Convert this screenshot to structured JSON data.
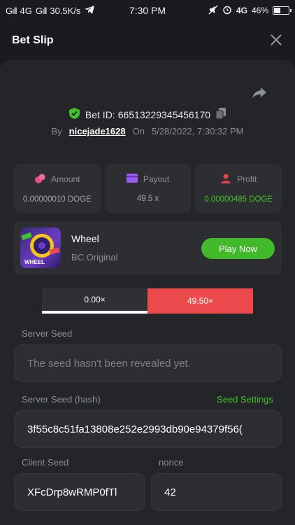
{
  "statusbar": {
    "signal1": "4G",
    "speed": "30.5K/s",
    "time": "7:30 PM",
    "network": "4G",
    "battery_percent": "46%",
    "battery_level": 0.46
  },
  "header": {
    "title": "Bet Slip"
  },
  "bet": {
    "id_label": "Bet ID:",
    "id_value": "66513229345456170",
    "by_label": "By",
    "username": "nicejade1628",
    "on_label": "On",
    "timestamp": "5/28/2022, 7:30:32 PM"
  },
  "stats": [
    {
      "label": "Amount",
      "value": "0.00000010 DOGE"
    },
    {
      "label": "Payout",
      "value": "49.5 x"
    },
    {
      "label": "Profit",
      "value": "0.00000485 DOGE"
    }
  ],
  "game": {
    "name": "Wheel",
    "provider": "BC Original",
    "play_label": "Play Now",
    "thumb_text": "WHEEL"
  },
  "multipliers": {
    "left": "0.00×",
    "right": "49.50×"
  },
  "server_seed": {
    "label": "Server Seed",
    "value": "The seed hasn't been revealed yet."
  },
  "server_seed_hash": {
    "label": "Server Seed (hash)",
    "settings_link": "Seed Settings",
    "value": "3f55c8c51fa13808e252e2993db90e94379f56("
  },
  "client_seed": {
    "label": "Client Seed",
    "value": "XFcDrp8wRMP0fTl"
  },
  "nonce": {
    "label": "nonce",
    "value": "42"
  },
  "colors": {
    "accent_green": "#43c22a",
    "loss_red": "#ed4a4d",
    "panel": "#232528"
  }
}
